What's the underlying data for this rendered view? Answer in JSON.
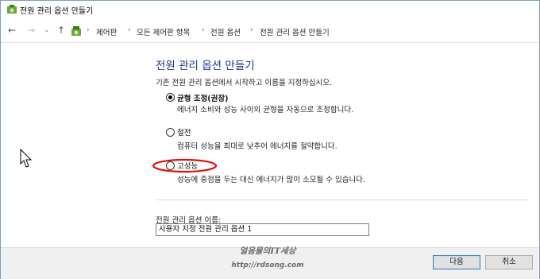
{
  "window": {
    "title": "전원 관리 옵션 만들기"
  },
  "breadcrumb": [
    "제어판",
    "모든 제어판 항목",
    "전원 옵션",
    "전원 관리 옵션 만들기"
  ],
  "heading": "전원 관리 옵션 만들기",
  "intro": "기존 전원 관리 옵션에서 시작하고 이름을 지정하십시오.",
  "options": [
    {
      "label": "균형 조정(권장)",
      "description": "에너지 소비와 성능 사이의 균형을 자동으로 조정합니다.",
      "selected": true
    },
    {
      "label": "절전",
      "description": "컴퓨터 성능을 최대로 낮추어 에너지를 절약합니다.",
      "selected": false
    },
    {
      "label": "고성능",
      "description": "성능에 중점을 두는 대신 에너지가 많이 소모될 수 있습니다.",
      "selected": false
    }
  ],
  "plan_name": {
    "label": "전원 관리 옵션 이름:",
    "value": "사용자 지정 전원 관리 옵션 1"
  },
  "buttons": {
    "next": "다음",
    "cancel": "취소"
  },
  "watermark": {
    "line1": "얼음물의IT세상",
    "line2": "http://rdsong.com"
  },
  "colors": {
    "heading": "#1e3287",
    "annotation": "#e01010"
  }
}
